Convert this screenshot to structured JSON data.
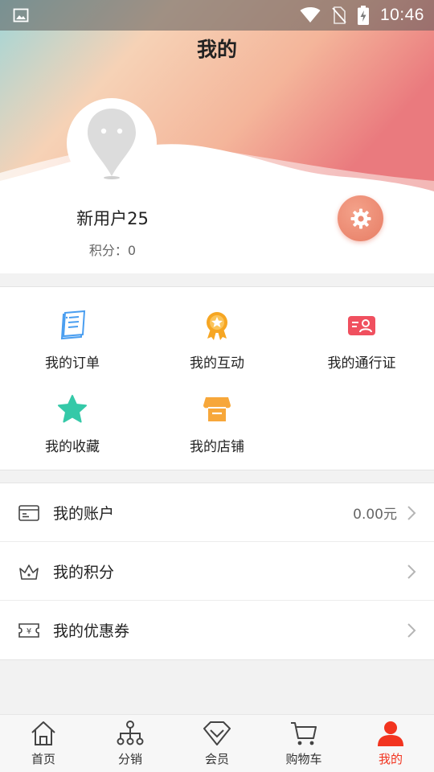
{
  "status_bar": {
    "time": "10:46"
  },
  "header": {
    "title": "我的"
  },
  "profile": {
    "username": "新用户25",
    "points_text": "积分：0"
  },
  "grid": {
    "items": [
      {
        "label": "我的订单",
        "icon": "order-list-icon"
      },
      {
        "label": "我的互动",
        "icon": "medal-icon"
      },
      {
        "label": "我的通行证",
        "icon": "id-card-icon"
      },
      {
        "label": "我的收藏",
        "icon": "star-icon"
      },
      {
        "label": "我的店铺",
        "icon": "store-icon"
      }
    ]
  },
  "list": {
    "rows": [
      {
        "label": "我的账户",
        "value": "0.00元",
        "icon": "card-icon"
      },
      {
        "label": "我的积分",
        "value": "",
        "icon": "crown-icon"
      },
      {
        "label": "我的优惠券",
        "value": "",
        "icon": "coupon-icon"
      }
    ]
  },
  "nav": {
    "items": [
      {
        "label": "首页",
        "icon": "home-icon"
      },
      {
        "label": "分销",
        "icon": "network-icon"
      },
      {
        "label": "会员",
        "icon": "diamond-icon"
      },
      {
        "label": "购物车",
        "icon": "cart-icon"
      },
      {
        "label": "我的",
        "icon": "user-icon",
        "active": true
      }
    ]
  },
  "colors": {
    "accent": "#f2341f",
    "settings": "#e98a72",
    "star": "#35c9a8",
    "medal": "#f6a623",
    "card": "#f0505f",
    "order": "#4a9ef0",
    "store": "#f7a73a"
  }
}
